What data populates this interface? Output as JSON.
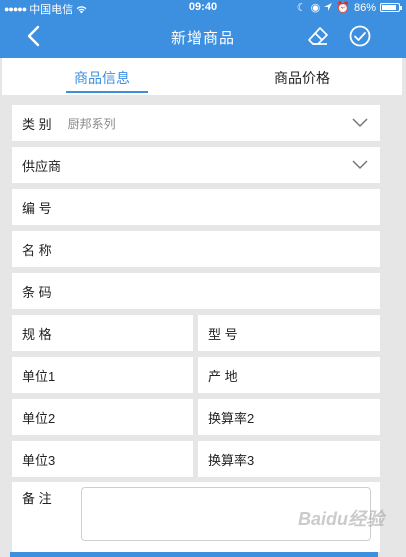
{
  "status_bar": {
    "carrier": "中国电信",
    "time": "09:40",
    "battery": "86%",
    "battery_level": 0.86
  },
  "navbar": {
    "title": "新增商品",
    "back_icon": "chevron-left-icon",
    "eraser_icon": "eraser-icon",
    "confirm_icon": "check-circle-icon"
  },
  "tabs": [
    {
      "label": "商品信息",
      "active": true
    },
    {
      "label": "商品价格",
      "active": false
    }
  ],
  "form": {
    "category": {
      "label": "类  别",
      "value": "厨邦系列"
    },
    "supplier": {
      "label": "供应商",
      "value": ""
    },
    "code": {
      "label": "编  号"
    },
    "name": {
      "label": "名  称"
    },
    "barcode": {
      "label": "条  码"
    },
    "spec": {
      "label": "规  格"
    },
    "model": {
      "label": "型  号"
    },
    "unit1": {
      "label": "单位1"
    },
    "origin": {
      "label": "产  地"
    },
    "unit2": {
      "label": "单位2"
    },
    "rate2": {
      "label": "换算率2"
    },
    "unit3": {
      "label": "单位3"
    },
    "rate3": {
      "label": "换算率3"
    },
    "notes": {
      "label": "备  注",
      "value": ""
    }
  },
  "watermark": "Baidu经验",
  "colors": {
    "brand": "#3d8fe0",
    "background": "#e6e6e6"
  }
}
